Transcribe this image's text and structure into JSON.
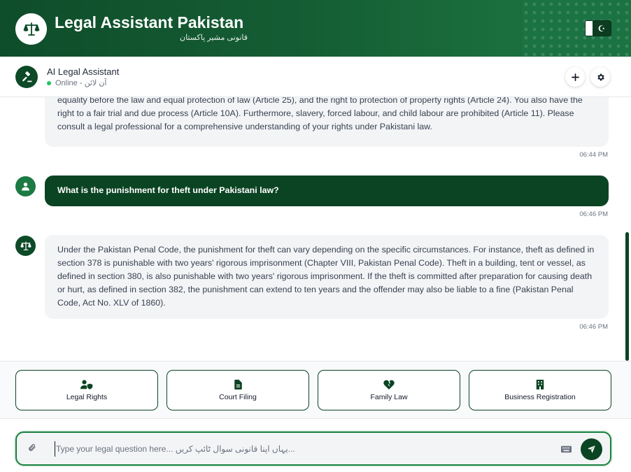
{
  "header": {
    "title": "Legal Assistant Pakistan",
    "subtitle": "قانونی مشیر پاکستان"
  },
  "chat_header": {
    "assistant_name": "AI Legal Assistant",
    "status": "Online - آن لائن"
  },
  "messages": [
    {
      "role": "assistant",
      "text": "equality before the law and equal protection of law (Article 25), and the right to protection of property rights (Article 24). You also have the right to a fair trial and due process (Article 10A). Furthermore, slavery, forced labour, and child labour are prohibited (Article 11). Please consult a legal professional for a comprehensive understanding of your rights under Pakistani law.",
      "time": "06:44 PM"
    },
    {
      "role": "user",
      "text": "What is the punishment for theft under Pakistani law?",
      "time": "06:46 PM"
    },
    {
      "role": "assistant",
      "text": "Under the Pakistan Penal Code, the punishment for theft can vary depending on the specific circumstances. For instance, theft as defined in section 378 is punishable with two years' rigorous imprisonment (Chapter VIII, Pakistan Penal Code). Theft in a building, tent or vessel, as defined in section 380, is also punishable with two years' rigorous imprisonment. If the theft is committed after preparation for causing death or hurt, as defined in section 382, the punishment can extend to ten years and the offender may also be liable to a fine (Pakistan Penal Code, Act No. XLV of 1860).",
      "time": "06:46 PM"
    }
  ],
  "quick_actions": [
    {
      "label": "Legal Rights",
      "icon": "user-shield-icon"
    },
    {
      "label": "Court Filing",
      "icon": "file-icon"
    },
    {
      "label": "Family Law",
      "icon": "heart-broken-icon"
    },
    {
      "label": "Business Registration",
      "icon": "building-icon"
    }
  ],
  "input": {
    "placeholder": "Type your legal question here... یہاں اپنا قانونی سوال ٹائپ کریں..."
  },
  "colors": {
    "primary": "#0b4423",
    "accent": "#15803d",
    "online": "#22c55e"
  }
}
